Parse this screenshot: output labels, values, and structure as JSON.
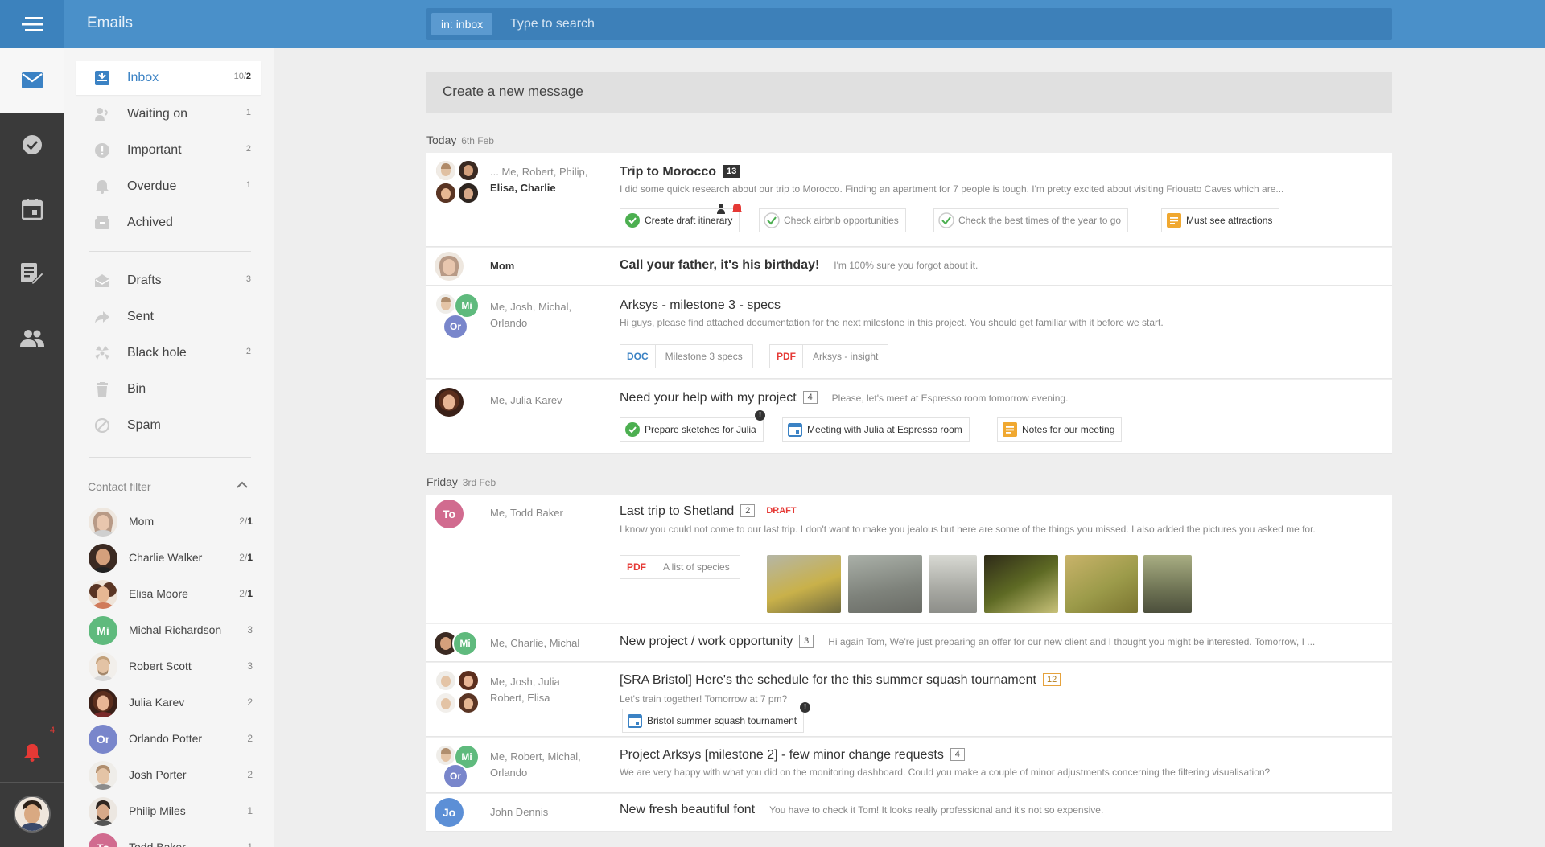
{
  "app": {
    "title": "Emails"
  },
  "search": {
    "scope_prefix": "in:",
    "scope_value": "inbox",
    "placeholder": "Type to search"
  },
  "rail": {
    "alert_count": "4"
  },
  "folders": [
    {
      "label": "Inbox",
      "count": "10/",
      "count_bold": "2",
      "icon": "inbox-icon"
    },
    {
      "label": "Waiting on",
      "count": "1",
      "icon": "waiting-icon"
    },
    {
      "label": "Important",
      "count": "2",
      "icon": "important-icon"
    },
    {
      "label": "Overdue",
      "count": "1",
      "icon": "bell-icon"
    },
    {
      "label": "Achived",
      "count": "",
      "icon": "archive-icon"
    },
    {
      "label": "Drafts",
      "count": "3",
      "icon": "drafts-icon"
    },
    {
      "label": "Sent",
      "count": "",
      "icon": "sent-icon"
    },
    {
      "label": "Black hole",
      "count": "2",
      "icon": "black-hole-icon"
    },
    {
      "label": "Bin",
      "count": "",
      "icon": "bin-icon"
    },
    {
      "label": "Spam",
      "count": "",
      "icon": "spam-icon"
    }
  ],
  "contact_filter": {
    "title": "Contact filter",
    "contacts": [
      {
        "name": "Mom",
        "count": "2/",
        "count_bold": "1"
      },
      {
        "name": "Charlie Walker",
        "count": "2/",
        "count_bold": "1"
      },
      {
        "name": "Elisa Moore",
        "count": "2/",
        "count_bold": "1"
      },
      {
        "name": "Michal Richardson",
        "count": "3",
        "initials": "Mi"
      },
      {
        "name": "Robert Scott",
        "count": "3"
      },
      {
        "name": "Julia Karev",
        "count": "2"
      },
      {
        "name": "Orlando Potter",
        "count": "2",
        "initials": "Or"
      },
      {
        "name": "Josh Porter",
        "count": "2"
      },
      {
        "name": "Philip Miles",
        "count": "1"
      },
      {
        "name": "Todd Baker",
        "count": "1",
        "initials": "To"
      }
    ]
  },
  "compose": {
    "label": "Create a new message"
  },
  "days": [
    {
      "label": "Today",
      "date": "6th Feb"
    },
    {
      "label": "Friday",
      "date": "3rd Feb"
    }
  ],
  "emails": [
    {
      "participants_prefix": "... Me, Robert, Philip,",
      "participants_bold": "Elisa, Charlie",
      "subject": "Trip to Morocco",
      "count": "13",
      "snippet": "I did some quick research about our trip to Morocco. Finding an apartment for 7 people is tough. I'm pretty excited about visiting Friouato Caves which are...",
      "tasks": [
        "Create draft itinerary",
        "Check airbnb opportunities",
        "Check the best times of the year to go",
        "Must see attractions"
      ]
    },
    {
      "participants": "Mom",
      "subject": "Call your father, it's his birthday!",
      "snippet": "I'm 100% sure you forgot about it."
    },
    {
      "participants": "Me, Josh, Michal, Orlando",
      "subject": "Arksys - milestone 3 - specs",
      "snippet": "Hi guys, please find attached documentation for the next milestone in this project. You should get familiar with it before we start.",
      "files": [
        {
          "type": "DOC",
          "name": "Milestone 3 specs"
        },
        {
          "type": "PDF",
          "name": "Arksys - insight"
        }
      ]
    },
    {
      "participants": "Me, Julia Karev",
      "subject": "Need your help with my project",
      "count": "4",
      "snippet": "Please, let's meet at Espresso room tomorrow evening.",
      "tasks": [
        "Prepare sketches for Julia",
        "Meeting with Julia at Espresso room",
        "Notes for our meeting"
      ]
    },
    {
      "participants": "Me, Todd Baker",
      "subject": "Last trip to Shetland",
      "count": "2",
      "draft": "DRAFT",
      "snippet": "I know you could not come to our last trip. I don't want to make you jealous but here are some of the things you missed. I also added the pictures you asked me for.",
      "files": [
        {
          "type": "PDF",
          "name": "A list of species"
        }
      ]
    },
    {
      "participants": "Me, Charlie, Michal",
      "subject": "New project / work opportunity",
      "count": "3",
      "snippet": "Hi again Tom, We're just preparing an offer for our new client and I thought you might be interested. Tomorrow, I ..."
    },
    {
      "participants": "Me, Josh, Julia Robert, Elisa",
      "subject": "[SRA Bristol] Here's the schedule for the this summer squash tournament",
      "count": "12",
      "snippet": "Let's train together! Tomorrow at 7 pm?",
      "tasks": [
        "Bristol summer squash tournament"
      ]
    },
    {
      "participants": "Me, Robert, Michal, Orlando",
      "subject": "Project Arksys [milestone 2] - few minor change requests",
      "count": "4",
      "snippet": "We are very happy with what you did on the monitoring dashboard. Could you make a couple of minor adjustments concerning the filtering visualisation?"
    },
    {
      "participants": "John Dennis",
      "subject": "New fresh beautiful font",
      "snippet": "You have to check it Tom! It looks really professional and it's not so expensive.",
      "initials": "Jo"
    }
  ],
  "colors": {
    "accent": "#4a90c9",
    "rail": "#3a3a3a",
    "green": "#4caf50",
    "alert": "#e53935",
    "amber": "#f0a830"
  }
}
